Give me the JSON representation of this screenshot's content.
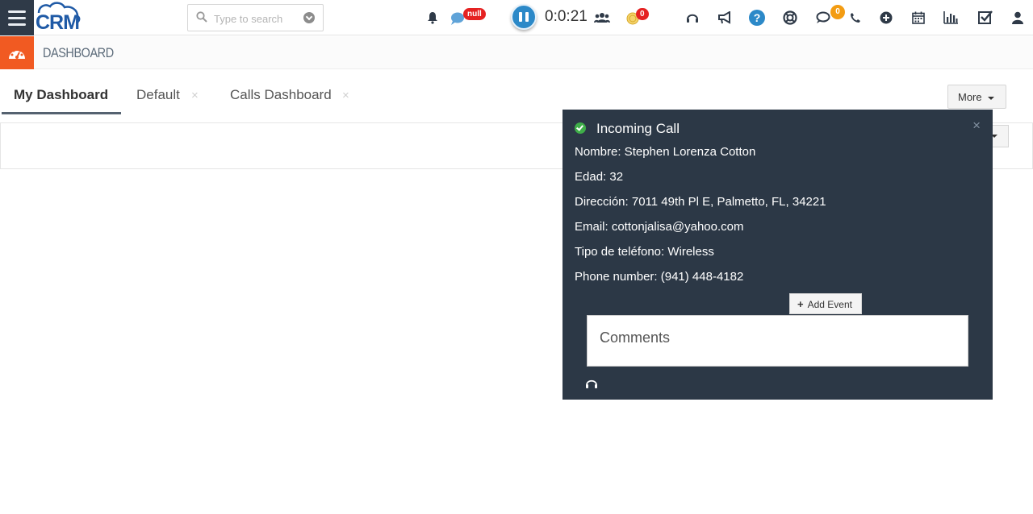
{
  "header": {
    "logo_text": "CRM",
    "search_placeholder": "Type to search",
    "chat_badge": "null",
    "timer": "0:0:21",
    "coins_badge": "0",
    "messages_badge": "0"
  },
  "breadcrumb": {
    "title": "DASHBOARD"
  },
  "tabs": [
    {
      "label": "My Dashboard"
    },
    {
      "label": "Default",
      "close": "×"
    },
    {
      "label": "Calls Dashboard",
      "close": "×"
    }
  ],
  "more_button": {
    "label": "More"
  },
  "incoming_call": {
    "title": "Incoming Call",
    "close": "×",
    "lines": [
      "Nombre: Stephen Lorenza Cotton",
      "Edad: 32",
      "Dirección: 7011 49th Pl E, Palmetto, FL, 34221",
      "Email: cottonjalisa@yahoo.com",
      "Tipo de teléfono: Wireless",
      "Phone number: (941) 448-4182"
    ],
    "add_event_label": "Add Event",
    "comments_placeholder": "Comments"
  },
  "colors": {
    "sidebar_dark": "#2f3a48",
    "accent_orange": "#f15a22",
    "popup_bg": "#2c3846",
    "pause_blue": "#2c89c8",
    "badge_red": "#e52222",
    "badge_orange": "#f39c12",
    "success_green": "#3fae49"
  }
}
